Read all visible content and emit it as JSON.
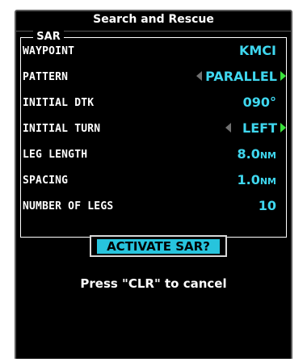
{
  "window": {
    "title": "Search and Rescue"
  },
  "sar": {
    "section_label": "SAR",
    "rows": [
      {
        "label": "WAYPOINT",
        "value": "KMCI",
        "unit": ""
      },
      {
        "label": "PATTERN",
        "value": "PARALLEL",
        "unit": ""
      },
      {
        "label": "INITIAL DTK",
        "value": "090°",
        "unit": ""
      },
      {
        "label": "INITIAL TURN",
        "value": "LEFT",
        "unit": ""
      },
      {
        "label": "LEG LENGTH",
        "value": "8.0",
        "unit": "NM"
      },
      {
        "label": "SPACING",
        "value": "1.0",
        "unit": "NM"
      },
      {
        "label": "NUMBER OF LEGS",
        "value": "10",
        "unit": ""
      }
    ]
  },
  "activate_button": {
    "label": "ACTIVATE SAR?"
  },
  "hint": {
    "text": "Press \"CLR\" to cancel"
  },
  "colors": {
    "background": "#000000",
    "value_cyan": "#3fd7ef",
    "highlight_cyan": "#27c4dd",
    "arrow_green": "#39e33a",
    "arrow_gray": "#707070"
  },
  "icons": {
    "left_arrow": "triangle-left-icon",
    "right_arrow": "triangle-right-icon"
  }
}
